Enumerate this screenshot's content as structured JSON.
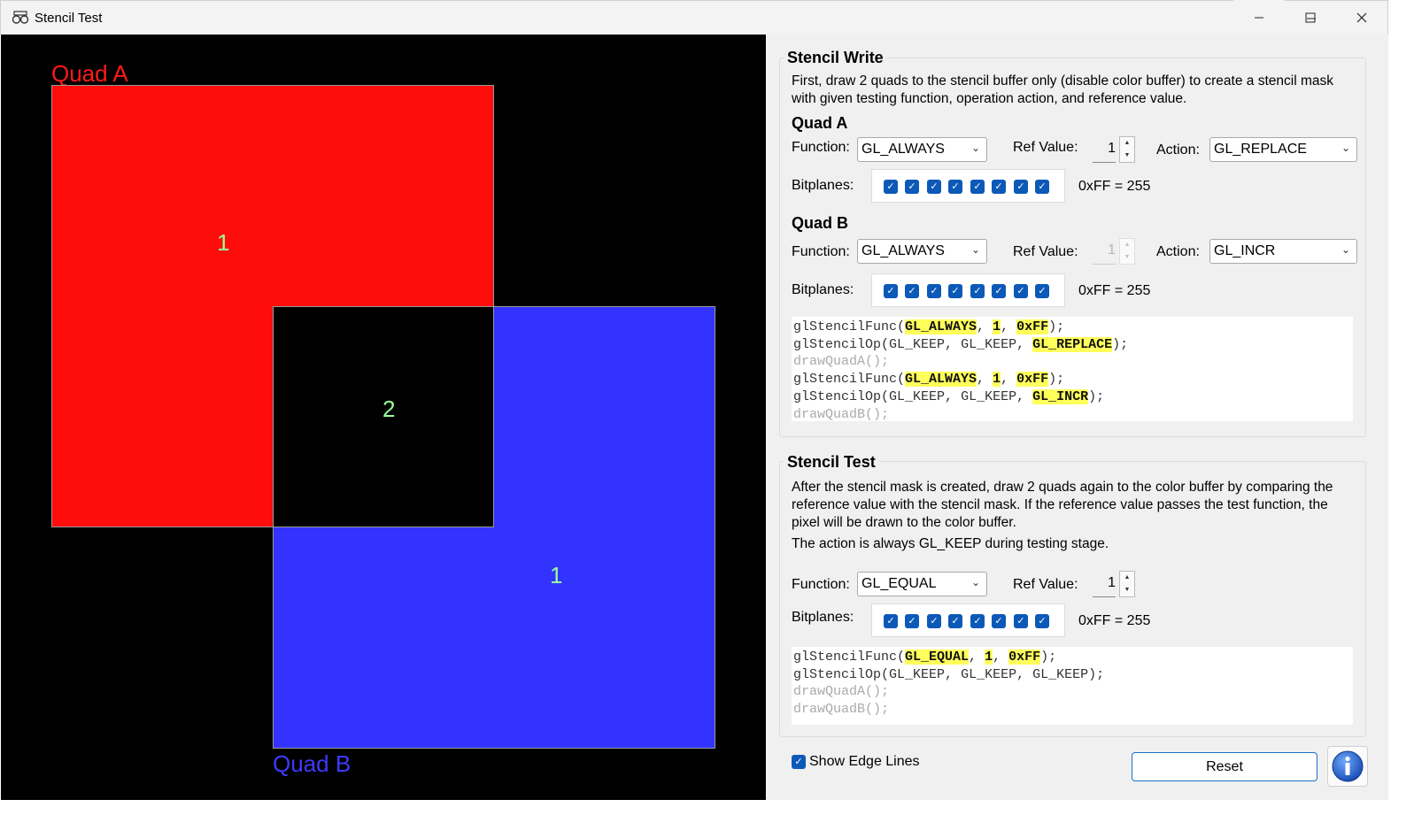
{
  "window": {
    "title": "Stencil Test"
  },
  "viewport": {
    "quad_a_label": "Quad A",
    "quad_b_label": "Quad B",
    "region_a_value": "1",
    "overlap_value": "2",
    "region_b_value": "1",
    "colors": {
      "quad_a": "#ff0d0d",
      "quad_b": "#3333ff",
      "label_a": "#ff1a1a",
      "label_b": "#3b3bff",
      "numbers": "#99ff99"
    }
  },
  "stencil_write": {
    "title": "Stencil Write",
    "description": "First, draw 2 quads to the stencil buffer only (disable color buffer) to create a stencil mask with given testing function, operation action, and reference value.",
    "quad_a": {
      "title": "Quad A",
      "function_label": "Function:",
      "function_value": "GL_ALWAYS",
      "ref_label": "Ref Value:",
      "ref_value": "1",
      "action_label": "Action:",
      "action_value": "GL_REPLACE",
      "bitplanes_label": "Bitplanes:",
      "bitplanes_value": "0xFF = 255"
    },
    "quad_b": {
      "title": "Quad B",
      "function_label": "Function:",
      "function_value": "GL_ALWAYS",
      "ref_label": "Ref Value:",
      "ref_value": "1",
      "action_label": "Action:",
      "action_value": "GL_INCR",
      "bitplanes_label": "Bitplanes:",
      "bitplanes_value": "0xFF = 255"
    }
  },
  "stencil_test": {
    "title": "Stencil Test",
    "description": "After the stencil mask is created, draw 2 quads again to the color buffer by comparing the reference value with the stencil mask. If the reference value passes the test function, the pixel will be drawn to the color buffer.",
    "note": "The action is always GL_KEEP during testing stage.",
    "function_label": "Function:",
    "function_value": "GL_EQUAL",
    "ref_label": "Ref Value:",
    "ref_value": "1",
    "bitplanes_label": "Bitplanes:",
    "bitplanes_value": "0xFF = 255"
  },
  "code": {
    "fn_func": "glStencilFunc(",
    "fn_op": "glStencilOp(",
    "sep": ", ",
    "close": ");",
    "keep": "GL_KEEP",
    "draw_a": "drawQuadA();",
    "draw_b": "drawQuadB();",
    "always": "GL_ALWAYS",
    "equal": "GL_EQUAL",
    "one": "1",
    "mask": "0xFF",
    "replace": "GL_REPLACE",
    "incr": "GL_INCR"
  },
  "bottom": {
    "show_edge_label": "Show Edge Lines",
    "show_edge_checked": true,
    "reset_label": "Reset"
  },
  "accent_color": "#0c59b8"
}
